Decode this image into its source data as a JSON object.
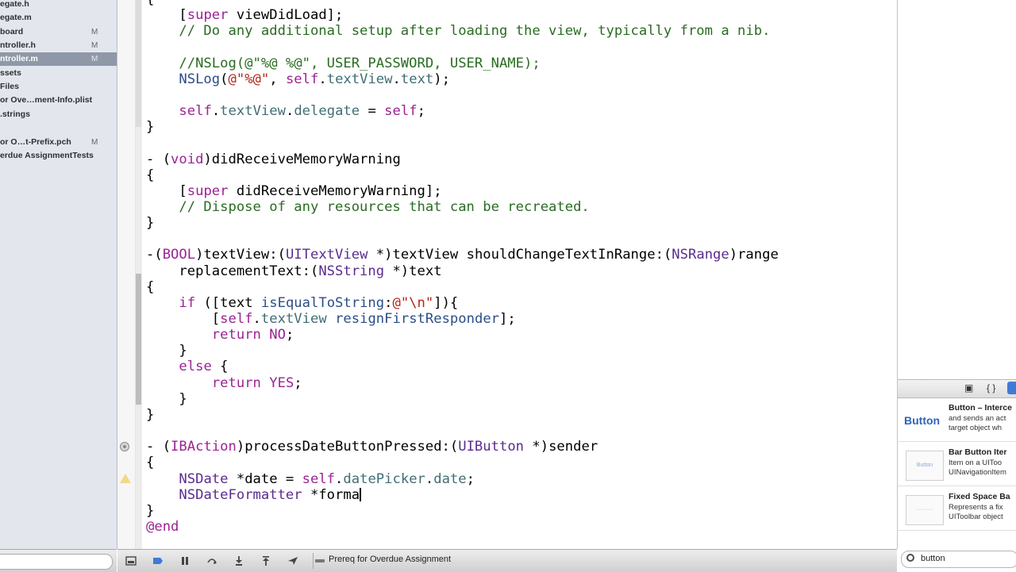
{
  "navigator": {
    "items": [
      {
        "label": "egate.h",
        "badge": ""
      },
      {
        "label": "egate.m",
        "badge": ""
      },
      {
        "label": "board",
        "badge": "M"
      },
      {
        "label": "ntroller.h",
        "badge": "M"
      },
      {
        "label": "ntroller.m",
        "badge": "M",
        "selected": true
      },
      {
        "label": "ssets",
        "badge": ""
      },
      {
        "label": "Files",
        "badge": ""
      },
      {
        "label": "or Ove…ment-Info.plist",
        "badge": ""
      },
      {
        "label": ".strings",
        "badge": ""
      },
      {
        "label": "",
        "badge": ""
      },
      {
        "label": "or O…t-Prefix.pch",
        "badge": "M"
      },
      {
        "label": "erdue AssignmentTests",
        "badge": ""
      }
    ]
  },
  "code_lines": [
    [
      {
        "t": "{"
      }
    ],
    [
      {
        "t": "    ["
      },
      {
        "t": "super",
        "c": "keyword"
      },
      {
        "t": " viewDidLoad];"
      }
    ],
    [
      {
        "t": "    // Do any additional setup after loading the view, typically from a nib.",
        "c": "comment"
      }
    ],
    [],
    [
      {
        "t": "    //NSLog(@\"%@ %@\", USER_PASSWORD, USER_NAME);",
        "c": "comment"
      }
    ],
    [
      {
        "t": "    NSLog",
        "c": "method"
      },
      {
        "t": "("
      },
      {
        "t": "@\"%@\"",
        "c": "string"
      },
      {
        "t": ", "
      },
      {
        "t": "self",
        "c": "keyword"
      },
      {
        "t": "."
      },
      {
        "t": "textView",
        "c": "ivar"
      },
      {
        "t": "."
      },
      {
        "t": "text",
        "c": "ivar"
      },
      {
        "t": ");"
      }
    ],
    [],
    [
      {
        "t": "    "
      },
      {
        "t": "self",
        "c": "keyword"
      },
      {
        "t": "."
      },
      {
        "t": "textView",
        "c": "ivar"
      },
      {
        "t": "."
      },
      {
        "t": "delegate",
        "c": "ivar"
      },
      {
        "t": " = "
      },
      {
        "t": "self",
        "c": "keyword"
      },
      {
        "t": ";"
      }
    ],
    [
      {
        "t": "}"
      }
    ],
    [],
    [
      {
        "t": "- ("
      },
      {
        "t": "void",
        "c": "keyword"
      },
      {
        "t": ")didReceiveMemoryWarning"
      }
    ],
    [
      {
        "t": "{"
      }
    ],
    [
      {
        "t": "    ["
      },
      {
        "t": "super",
        "c": "keyword"
      },
      {
        "t": " didReceiveMemoryWarning];"
      }
    ],
    [
      {
        "t": "    // Dispose of any resources that can be recreated.",
        "c": "comment"
      }
    ],
    [
      {
        "t": "}"
      }
    ],
    [],
    [
      {
        "t": "-("
      },
      {
        "t": "BOOL",
        "c": "keyword"
      },
      {
        "t": ")textView:("
      },
      {
        "t": "UITextView",
        "c": "type"
      },
      {
        "t": " *)textView shouldChangeTextInRange:("
      },
      {
        "t": "NSRange",
        "c": "type"
      },
      {
        "t": ")range"
      }
    ],
    [
      {
        "t": "    replacementText:("
      },
      {
        "t": "NSString",
        "c": "type"
      },
      {
        "t": " *)text"
      }
    ],
    [
      {
        "t": "{"
      }
    ],
    [
      {
        "t": "    "
      },
      {
        "t": "if",
        "c": "keyword"
      },
      {
        "t": " ([text "
      },
      {
        "t": "isEqualToString",
        "c": "method"
      },
      {
        "t": ":"
      },
      {
        "t": "@\"\\n\"",
        "c": "string"
      },
      {
        "t": "]){"
      }
    ],
    [
      {
        "t": "        ["
      },
      {
        "t": "self",
        "c": "keyword"
      },
      {
        "t": "."
      },
      {
        "t": "textView",
        "c": "ivar"
      },
      {
        "t": " "
      },
      {
        "t": "resignFirstResponder",
        "c": "method"
      },
      {
        "t": "];"
      }
    ],
    [
      {
        "t": "        "
      },
      {
        "t": "return",
        "c": "keyword"
      },
      {
        "t": " "
      },
      {
        "t": "NO",
        "c": "keyword"
      },
      {
        "t": ";"
      }
    ],
    [
      {
        "t": "    }"
      }
    ],
    [
      {
        "t": "    "
      },
      {
        "t": "else",
        "c": "keyword"
      },
      {
        "t": " {"
      }
    ],
    [
      {
        "t": "        "
      },
      {
        "t": "return",
        "c": "keyword"
      },
      {
        "t": " "
      },
      {
        "t": "YES",
        "c": "keyword"
      },
      {
        "t": ";"
      }
    ],
    [
      {
        "t": "    }"
      }
    ],
    [
      {
        "t": "}"
      }
    ],
    [],
    [
      {
        "t": "- ("
      },
      {
        "t": "IBAction",
        "c": "keyword"
      },
      {
        "t": ")processDateButtonPressed:("
      },
      {
        "t": "UIButton",
        "c": "type"
      },
      {
        "t": " *)sender"
      }
    ],
    [
      {
        "t": "{"
      }
    ],
    [
      {
        "t": "    "
      },
      {
        "t": "NSDate",
        "c": "type"
      },
      {
        "t": " *date = "
      },
      {
        "t": "self",
        "c": "keyword"
      },
      {
        "t": "."
      },
      {
        "t": "datePicker",
        "c": "ivar"
      },
      {
        "t": "."
      },
      {
        "t": "date",
        "c": "ivar"
      },
      {
        "t": ";"
      }
    ],
    [
      {
        "t": "    "
      },
      {
        "t": "NSDateFormatter",
        "c": "type"
      },
      {
        "t": " *forma"
      },
      {
        "cursor": true
      }
    ],
    [
      {
        "t": "}"
      }
    ],
    [
      {
        "t": "@end",
        "c": "keyword"
      }
    ]
  ],
  "library": {
    "tabs": [
      "▣",
      "{ }"
    ],
    "items": [
      {
        "big": "Button",
        "title": "Button – Interce",
        "desc": [
          "and sends an act",
          "target object wh"
        ]
      },
      {
        "thumb": "Button",
        "title": "Bar Button Iter",
        "desc": [
          "Item on a UIToo",
          "UINavigationItem"
        ]
      },
      {
        "thumb": "·········",
        "title": "Fixed Space Ba",
        "desc": [
          "Represents a fix",
          "UIToolbar object"
        ]
      }
    ],
    "search_value": "button"
  },
  "debugbar": {
    "scheme_label": "Prereq for Overdue Assignment"
  }
}
